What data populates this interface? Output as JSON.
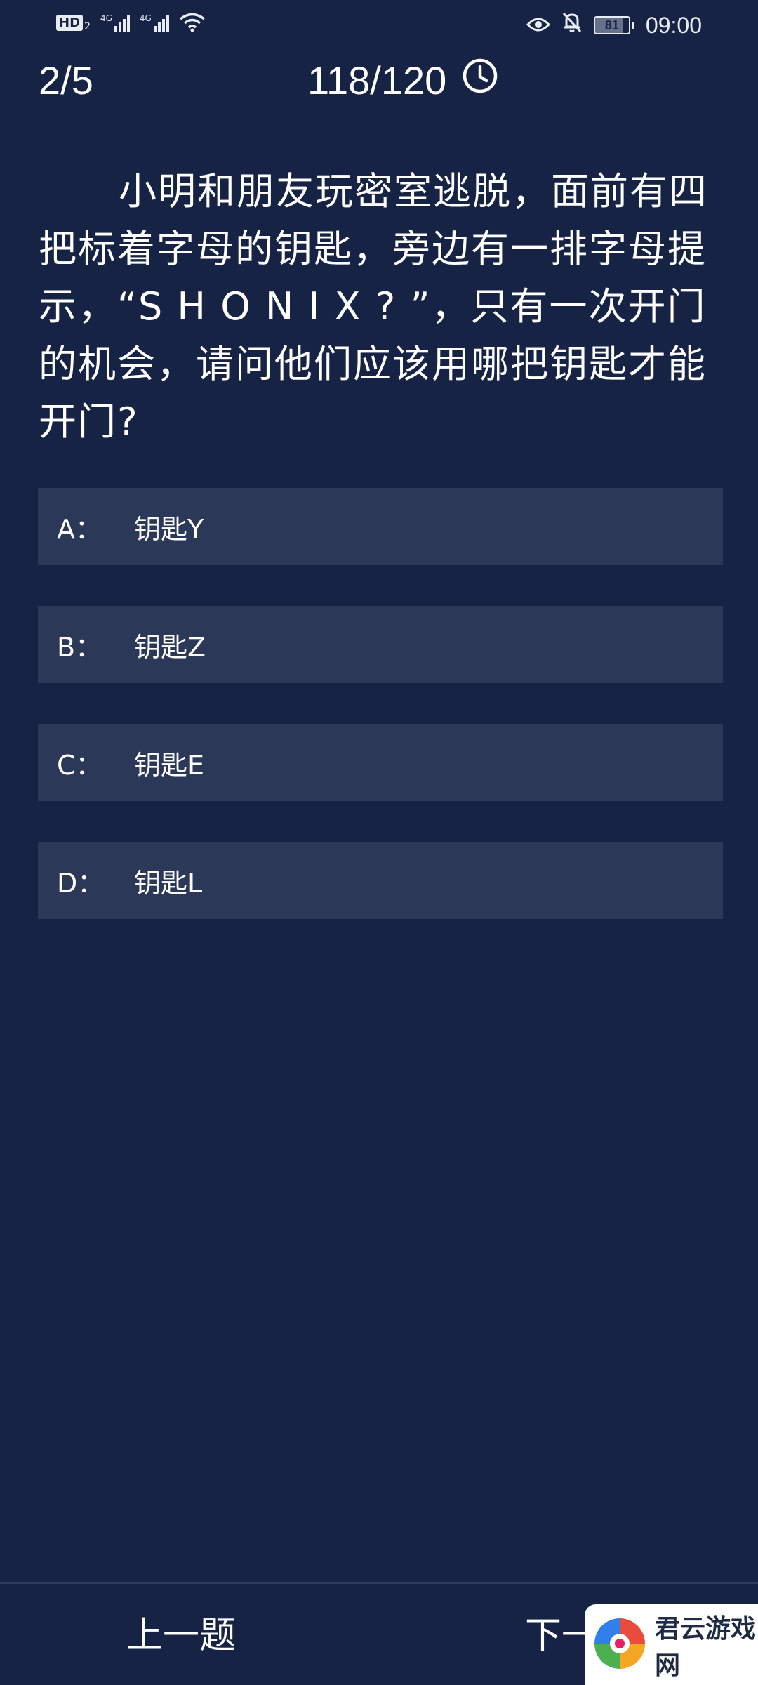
{
  "status_bar": {
    "hd_label": "HD",
    "hd_sub": "2",
    "network_1": "4G",
    "network_2": "4G",
    "battery_level": "81",
    "time": "09:00"
  },
  "header": {
    "progress": "2/5",
    "timer": "118/120"
  },
  "question": {
    "text": "小明和朋友玩密室逃脱，面前有四把标着字母的钥匙，旁边有一排字母提示，“S H O N I X ? ”，只有一次开门的机会，请问他们应该用哪把钥匙才能开门?"
  },
  "options": [
    {
      "letter": "A：",
      "text": "钥匙Y"
    },
    {
      "letter": "B：",
      "text": "钥匙Z"
    },
    {
      "letter": "C：",
      "text": "钥匙E"
    },
    {
      "letter": "D：",
      "text": "钥匙L"
    }
  ],
  "footer": {
    "prev_label": "上一题",
    "next_label": "下一题"
  },
  "watermark": {
    "text": "君云游戏网"
  },
  "colors": {
    "background": "#172345",
    "option_background": "#2b3858",
    "text": "#ffffff"
  },
  "icons": {
    "timer": "clock-icon",
    "eye": "eye-icon",
    "bell": "bell-off-icon",
    "wifi": "wifi-icon"
  }
}
